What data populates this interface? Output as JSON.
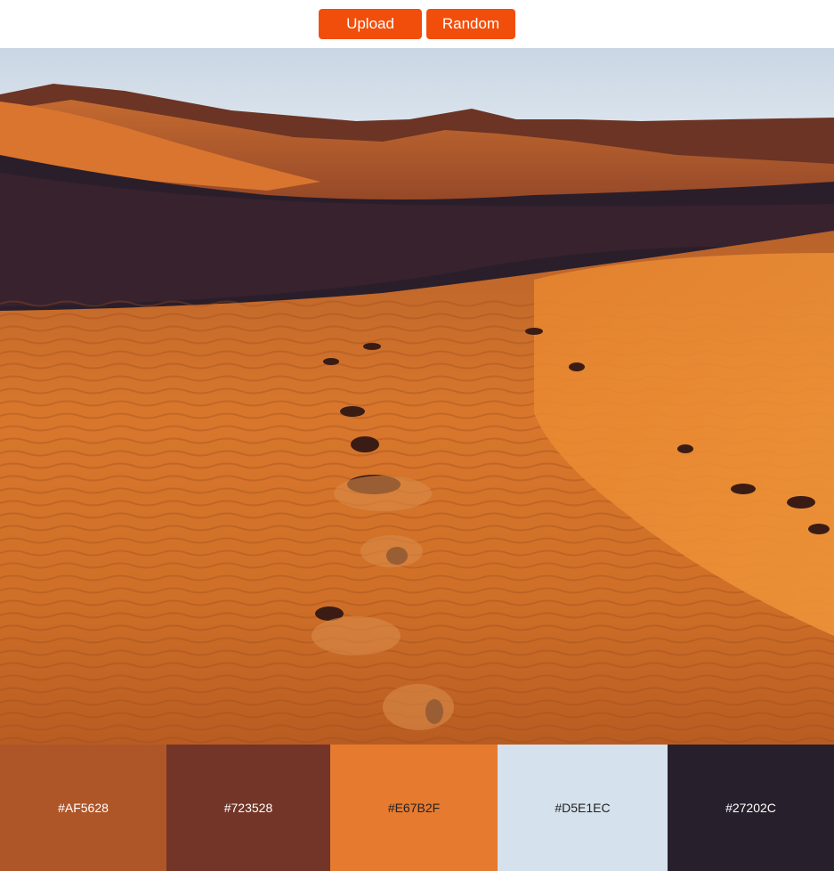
{
  "toolbar": {
    "upload_label": "Upload",
    "random_label": "Random",
    "button_color": "#F24E0B"
  },
  "photo": {
    "subject": "desert sand dunes with footprints"
  },
  "palette": {
    "swatches": [
      {
        "hex": "#AF5628",
        "text_color": "#FFFFFF"
      },
      {
        "hex": "#723528",
        "text_color": "#FFFFFF"
      },
      {
        "hex": "#E67B2F",
        "text_color": "#222222"
      },
      {
        "hex": "#D5E1EC",
        "text_color": "#222222"
      },
      {
        "hex": "#27202C",
        "text_color": "#FFFFFF"
      }
    ]
  }
}
